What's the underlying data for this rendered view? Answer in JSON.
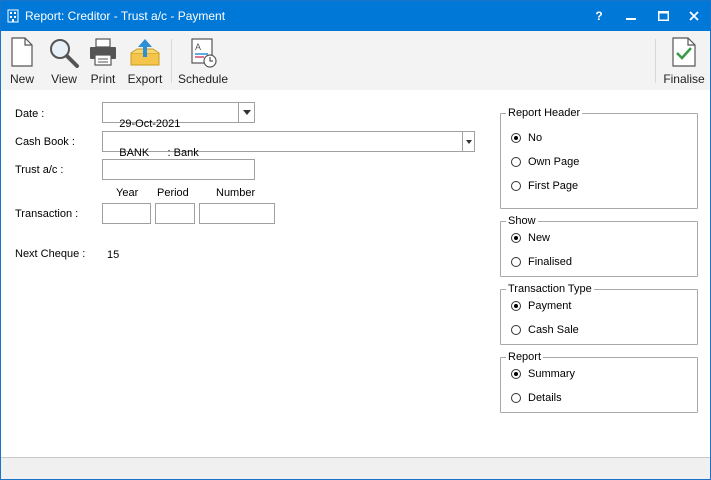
{
  "window": {
    "title": "Report: Creditor - Trust a/c - Payment",
    "controls": {
      "help": "?",
      "minimize": "—",
      "maximize": "☐",
      "close": "✕"
    }
  },
  "toolbar": {
    "new": "New",
    "view": "View",
    "print": "Print",
    "export": "Export",
    "schedule": "Schedule",
    "finalise": "Finalise"
  },
  "form": {
    "date_label": "Date :",
    "date_value": "29-Oct-2021",
    "cashbook_label": "Cash Book :",
    "cashbook_value": "BANK      : Bank",
    "trust_label": "Trust a/c :",
    "trust_value": "",
    "transaction_label": "Transaction :",
    "year_label": "Year",
    "period_label": "Period",
    "number_label": "Number",
    "year_value": "",
    "period_value": "",
    "number_value": "",
    "next_cheque_label": "Next Cheque :",
    "next_cheque_value": "15"
  },
  "groups": {
    "report_header": {
      "title": "Report Header",
      "options": [
        "No",
        "Own Page",
        "First Page"
      ],
      "selected": 0
    },
    "show": {
      "title": "Show",
      "options": [
        "New",
        "Finalised"
      ],
      "selected": 0
    },
    "transaction_type": {
      "title": "Transaction Type",
      "options": [
        "Payment",
        "Cash Sale"
      ],
      "selected": 0
    },
    "report": {
      "title": "Report",
      "options": [
        "Summary",
        "Details"
      ],
      "selected": 0
    }
  },
  "colors": {
    "titlebar": "#0078d7",
    "toolbar": "#f3f3f3",
    "accent_icon": "#2d8fd5"
  }
}
